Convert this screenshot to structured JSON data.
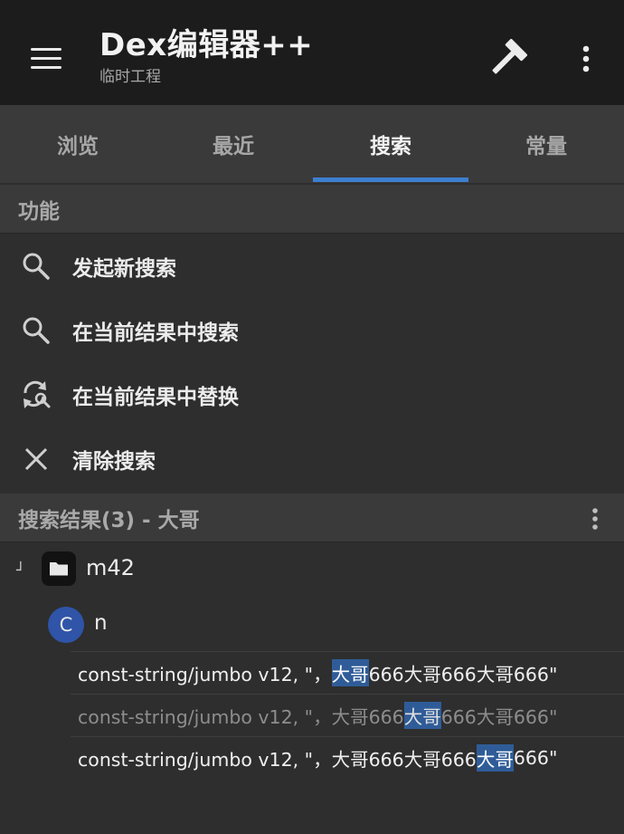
{
  "app": {
    "title": "Dex编辑器++",
    "subtitle": "临时工程"
  },
  "icons": {
    "menu": "hamburger-menu-icon",
    "build": "hammer-icon",
    "more": "more-vertical-icon"
  },
  "tabs": [
    {
      "label": "浏览",
      "active": false
    },
    {
      "label": "最近",
      "active": false
    },
    {
      "label": "搜索",
      "active": true
    },
    {
      "label": "常量",
      "active": false
    }
  ],
  "functions": {
    "header": "功能",
    "items": [
      {
        "label": "发起新搜索",
        "icon": "search-icon"
      },
      {
        "label": "在当前结果中搜索",
        "icon": "search-icon"
      },
      {
        "label": "在当前结果中替换",
        "icon": "replace-icon"
      },
      {
        "label": "清除搜索",
        "icon": "close-icon"
      }
    ]
  },
  "results": {
    "header": "搜索结果(3) - 大哥",
    "tree": {
      "expand_marker": "┘",
      "package": "m42",
      "class_badge": "C",
      "class_name": "n"
    },
    "rows": [
      {
        "prefix": "const-string/jumbo v12, \"，",
        "match": "大哥",
        "suffix": "666大哥666大哥666\"",
        "dim": false
      },
      {
        "prefix": "const-string/jumbo v12, \"，大哥666",
        "match": "大哥",
        "suffix": "666大哥666\"",
        "dim": true
      },
      {
        "prefix": "const-string/jumbo v12, \"，大哥666大哥666",
        "match": "大哥",
        "suffix": "666\"",
        "dim": false
      }
    ]
  },
  "colors": {
    "accent": "#3d7fd0",
    "highlight": "#2f5c98",
    "class_badge": "#2f54a8"
  }
}
